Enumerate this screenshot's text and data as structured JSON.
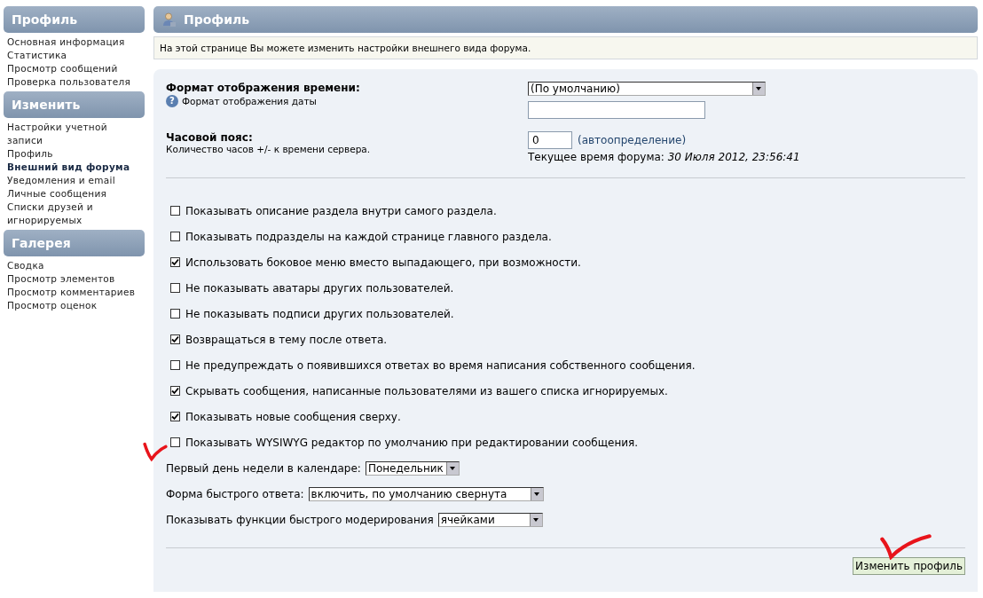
{
  "sidebar": {
    "sections": [
      {
        "title": "Профиль",
        "items": [
          {
            "label": "Основная информация",
            "selected": false
          },
          {
            "label": "Статистика",
            "selected": false
          },
          {
            "label": "Просмотр сообщений",
            "selected": false
          },
          {
            "label": "Проверка пользователя",
            "selected": false
          }
        ]
      },
      {
        "title": "Изменить",
        "items": [
          {
            "label": "Настройки учетной записи",
            "selected": false
          },
          {
            "label": "Профиль",
            "selected": false
          },
          {
            "label": "Внешний вид форума",
            "selected": true
          },
          {
            "label": "Уведомления и email",
            "selected": false
          },
          {
            "label": "Личные сообщения",
            "selected": false
          },
          {
            "label": "Списки друзей и игнорируемых",
            "selected": false
          }
        ]
      },
      {
        "title": "Галерея",
        "items": [
          {
            "label": "Сводка",
            "selected": false
          },
          {
            "label": "Просмотр элементов",
            "selected": false
          },
          {
            "label": "Просмотр комментариев",
            "selected": false
          },
          {
            "label": "Просмотр оценок",
            "selected": false
          }
        ]
      }
    ]
  },
  "header": {
    "title": "Профиль"
  },
  "info": "На этой странице Вы можете изменить настройки внешнего вида форума.",
  "time_format": {
    "label": "Формат отображения времени:",
    "hint": "Формат отображения даты",
    "help_icon": "?",
    "select": "(По умолчанию)"
  },
  "timezone": {
    "label": "Часовой пояс:",
    "hint": "Количество часов +/- к времени сервера.",
    "value": "0",
    "auto": "(автоопределение)",
    "current": "Текущее время форума: *30 Июля 2012, 23:56:41*"
  },
  "options": [
    {
      "label": "Показывать описание раздела внутри самого раздела.",
      "checked": false
    },
    {
      "label": "Показывать подразделы на каждой странице главного раздела.",
      "checked": false
    },
    {
      "label": "Использовать боковое меню вместо выпадающего, при возможности.",
      "checked": true
    },
    {
      "label": "Не показывать аватары других пользователей.",
      "checked": false
    },
    {
      "label": "Не показывать подписи других пользователей.",
      "checked": false
    },
    {
      "label": "Возвращаться в тему после ответа.",
      "checked": true
    },
    {
      "label": "Не предупреждать о появившихся ответах во время написания собственного сообщения.",
      "checked": false
    },
    {
      "label": "Скрывать сообщения, написанные пользователями из вашего списка игнорируемых.",
      "checked": true
    },
    {
      "label": "Показывать новые сообщения сверху.",
      "checked": true
    },
    {
      "label": "Показывать WYSIWYG редактор по умолчанию при редактировании сообщения.",
      "checked": false
    }
  ],
  "selects": [
    {
      "label": "Первый день недели в календаре:",
      "value": "Понедельник"
    },
    {
      "label": "Форма быстрого ответа:",
      "value": "включить, по умолчанию свернута"
    },
    {
      "label": "Показывать функции быстрого модерирования",
      "value": "ячейками"
    }
  ],
  "submit": "Изменить профиль"
}
